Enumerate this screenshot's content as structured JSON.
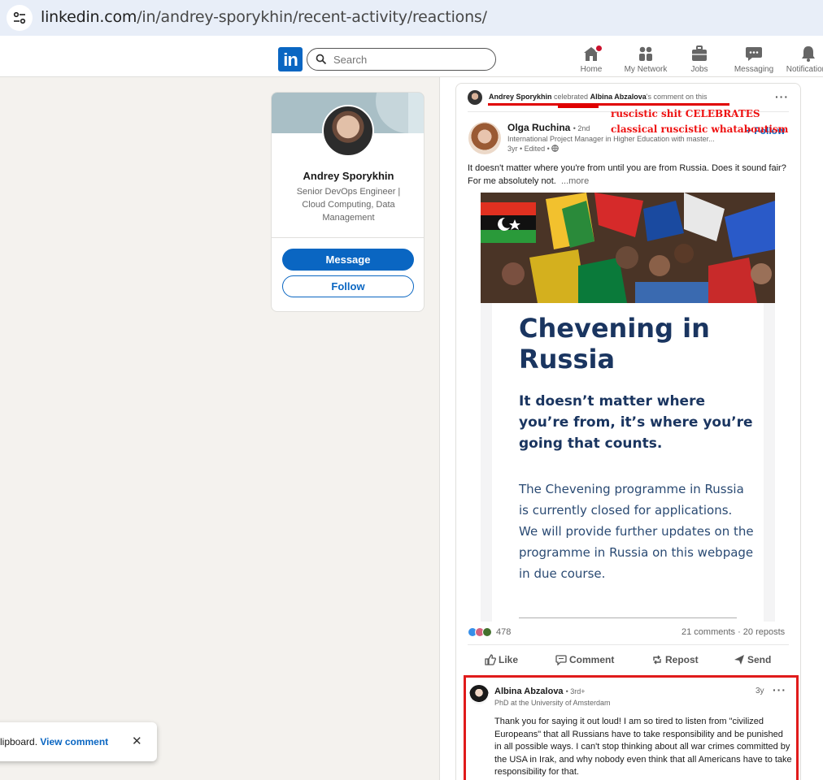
{
  "browser": {
    "url_host": "linkedin.com",
    "url_path": "/in/andrey-sporykhin/recent-activity/reactions/"
  },
  "nav": {
    "logo": "in",
    "search_placeholder": "Search",
    "items": [
      {
        "label": "Home",
        "icon": "home-icon"
      },
      {
        "label": "My Network",
        "icon": "people-icon"
      },
      {
        "label": "Jobs",
        "icon": "briefcase-icon"
      },
      {
        "label": "Messaging",
        "icon": "chat-icon"
      },
      {
        "label": "Notifications",
        "icon": "bell-icon"
      }
    ],
    "brand_color": "#0a66c2"
  },
  "profile": {
    "name": "Andrey Sporykhin",
    "headline": "Senior DevOps Engineer | Cloud Computing, Data Management",
    "message_label": "Message",
    "follow_label": "Follow"
  },
  "toast": {
    "text": "lipboard.",
    "link": "View comment",
    "close": "✕"
  },
  "activity": {
    "actor": "Andrey Sporykhin",
    "verb": "celebrated",
    "target": "Albina Abzalova",
    "suffix": "'s comment on this",
    "more": "···"
  },
  "annotation": {
    "line1": "ruscistic shit CELEBRATES",
    "line2": "classical ruscistic whataboutism",
    "color": "#ee1111"
  },
  "post": {
    "author": "Olga Ruchina",
    "degree": "• 2nd",
    "author_title": "International Project Manager in Higher Education with master...",
    "time": "3yr • Edited •",
    "follow": "+ Follow",
    "text": "It doesn't matter where you're from until you are from Russia. Does it sound fair? For me absolutely not.",
    "more": "...more",
    "doc_title": "Chevening in Russia",
    "doc_subtitle": "It doesn’t matter where you’re from, it’s where you’re going that counts.",
    "doc_body": "The Chevening programme in Russia is currently closed for applications. We will provide further updates on the programme in Russia on this webpage in due course.",
    "reactions_count": "478",
    "stats": "21 comments · 20 reposts",
    "actions": [
      "Like",
      "Comment",
      "Repost",
      "Send"
    ]
  },
  "comment": {
    "author": "Albina Abzalova",
    "degree": "• 3rd+",
    "title": "PhD at the University of Amsterdam",
    "time": "3y",
    "more": "···",
    "text": "Thank you for saying it out loud! I am so tired to listen from \"civilized Europeans\" that all Russians have to take responsibility and be punished in all possible ways. I can't stop thinking about all war crimes committed by the USA in Irak, and why nobody even think that all Americans have to take responsibility for that."
  }
}
